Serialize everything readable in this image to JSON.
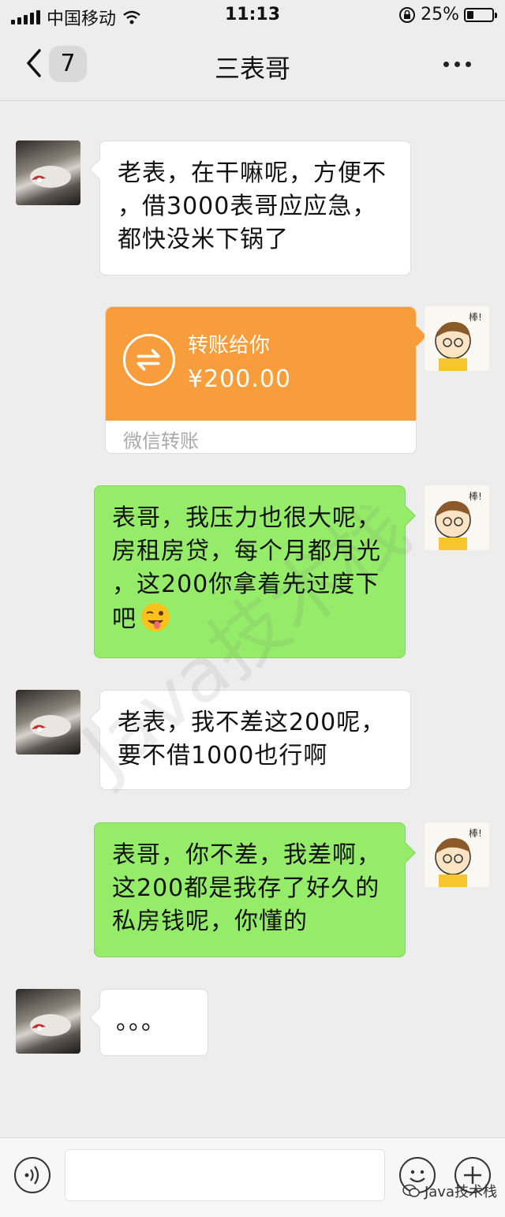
{
  "status_bar": {
    "carrier": "中国移动",
    "time": "11:13",
    "battery_percent": "25%",
    "battery_level": 0.25
  },
  "nav": {
    "back_badge": "7",
    "title": "三表哥"
  },
  "messages": [
    {
      "side": "left",
      "type": "text",
      "text": "老表，在干嘛呢，方便不\n，借3000表哥应应急，\n都快没米下锅了"
    },
    {
      "side": "right",
      "type": "transfer",
      "label": "转账给你",
      "amount": "¥200.00",
      "footer": "微信转账"
    },
    {
      "side": "right",
      "type": "text",
      "text": "表哥，我压力也很大呢，\n房租房贷，每个月都月光\n，这200你拿着先过度下\n吧",
      "emoji": "wink-tongue-emoji"
    },
    {
      "side": "left",
      "type": "text",
      "text": "老表，我不差这200呢，\n要不借1000也行啊"
    },
    {
      "side": "right",
      "type": "text",
      "text": "表哥，你不差，我差啊，\n这200都是我存了好久的\n私房钱呢，你懂的"
    },
    {
      "side": "left",
      "type": "text",
      "text": "。。。"
    }
  ],
  "sticker_text": "棒!",
  "input_bar": {
    "placeholder": "",
    "icons": [
      "voice-icon",
      "emoji-icon",
      "plus-icon"
    ]
  },
  "watermark": "Java技术栈",
  "corner_watermark": "Java技术栈",
  "colors": {
    "bg": "#ededed",
    "green_bubble": "#95ec69",
    "transfer_orange": "#f79d3b"
  }
}
